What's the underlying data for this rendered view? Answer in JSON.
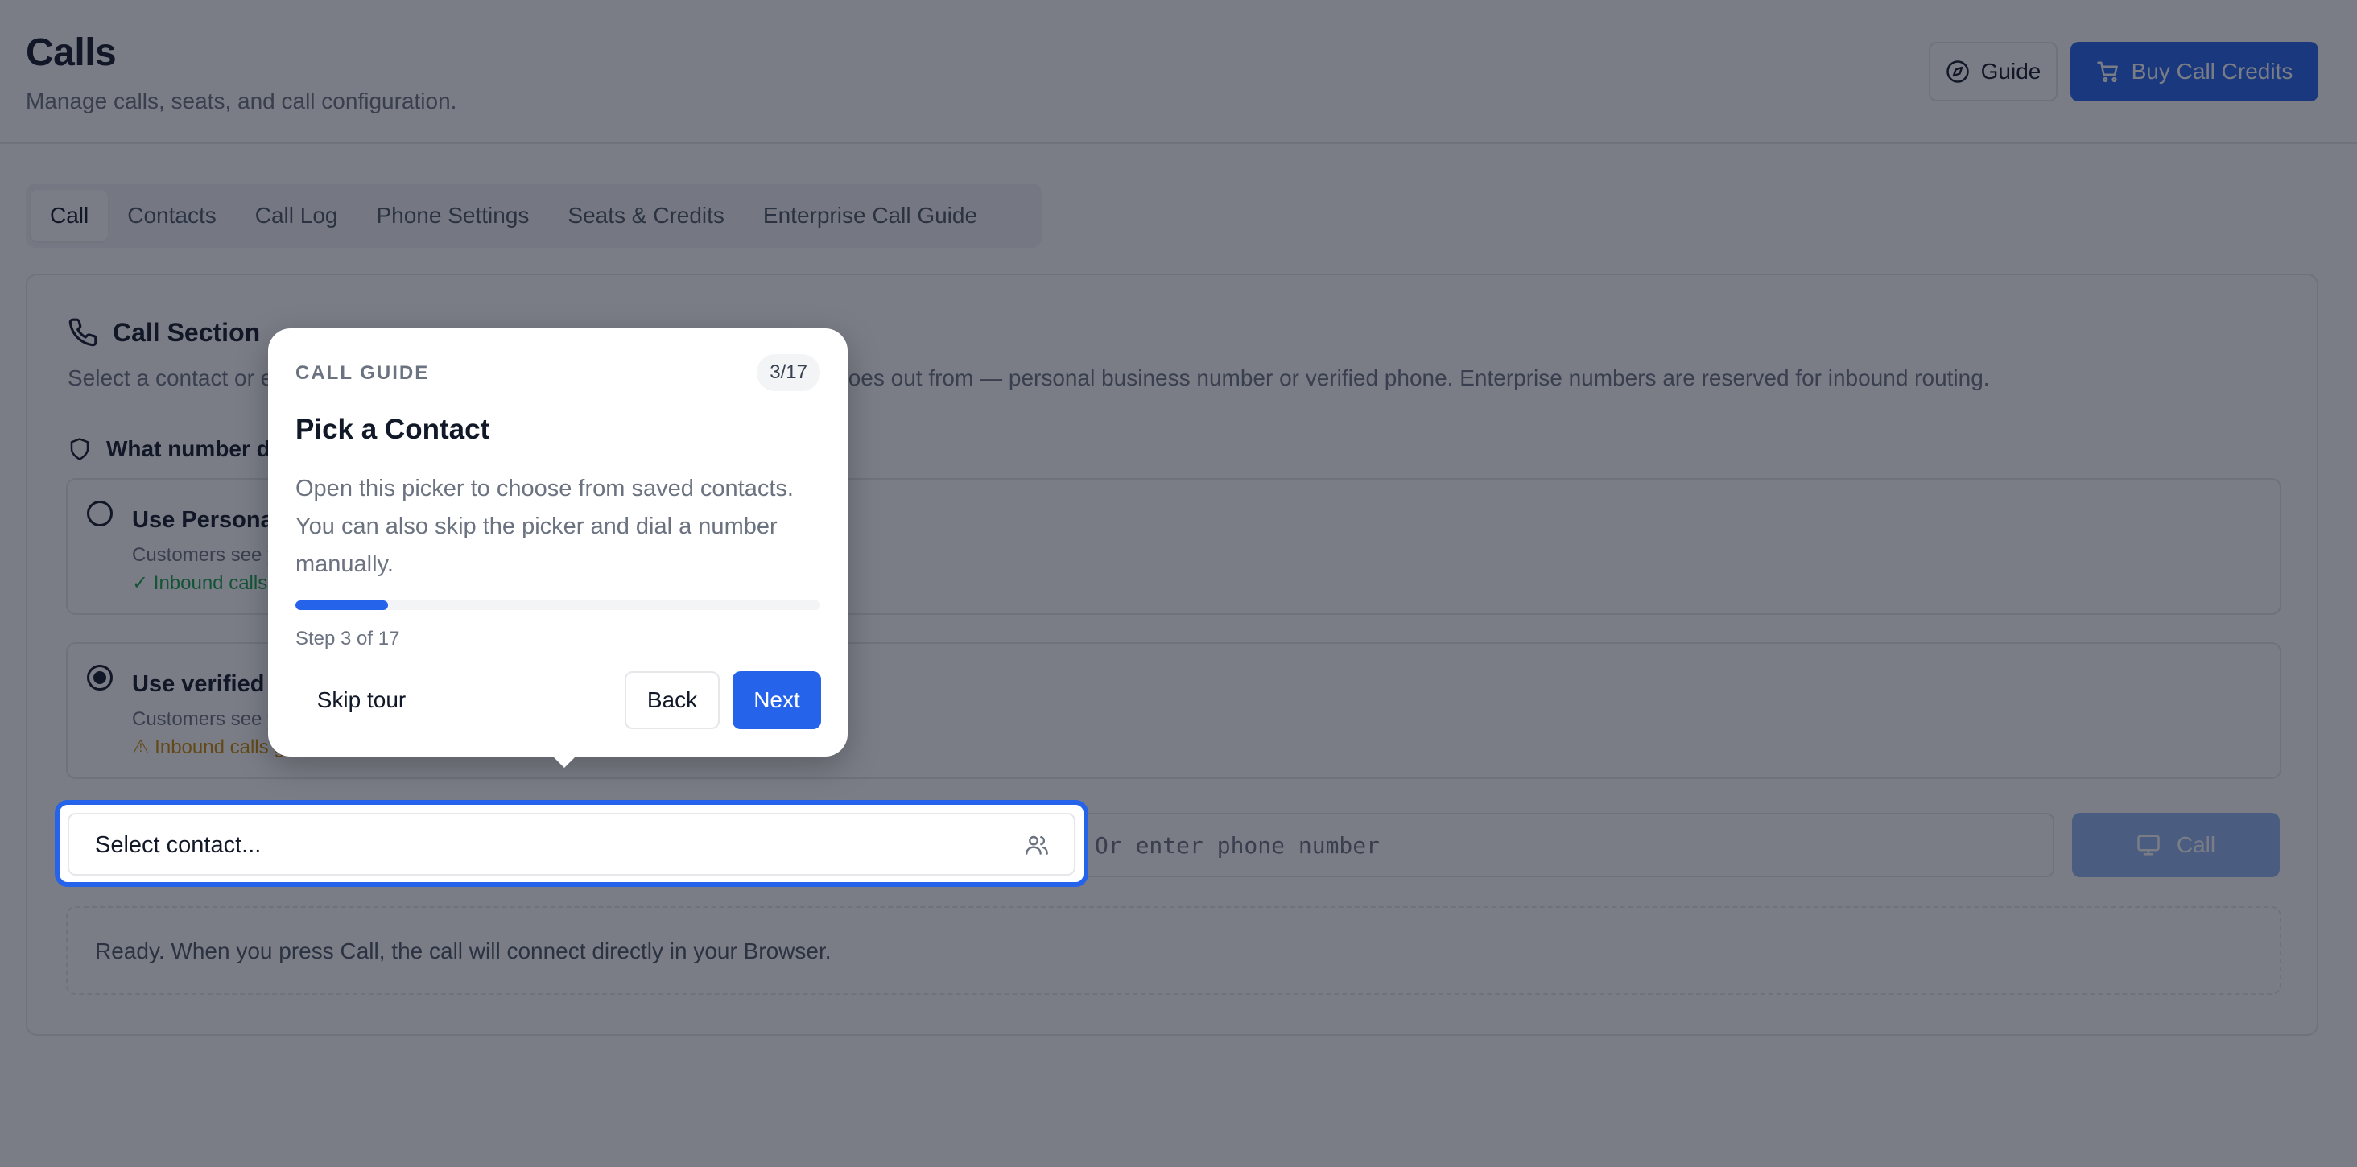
{
  "header": {
    "title": "Calls",
    "subtitle": "Manage calls, seats, and call configuration.",
    "guide_label": "Guide",
    "buy_label": "Buy Call Credits"
  },
  "tabs": [
    {
      "label": "Call",
      "active": true
    },
    {
      "label": "Contacts"
    },
    {
      "label": "Call Log"
    },
    {
      "label": "Phone Settings"
    },
    {
      "label": "Seats & Credits"
    },
    {
      "label": "Enterprise Call Guide"
    }
  ],
  "section": {
    "title": "Call Section",
    "description": "Select a contact or enter a phone number and choose which number the call goes out from — personal business number or verified phone. Enterprise numbers are reserved for inbound routing.",
    "question": "What number do customers see?"
  },
  "options": [
    {
      "title": "Use Personal business number",
      "subtitle": "Customers see your business number.",
      "note": "✓ Inbound calls route to you.",
      "checked": false
    },
    {
      "title": "Use verified phone",
      "subtitle": "Customers see your verified phone.",
      "note": "⚠ Inbound calls go to your phone directly.",
      "checked": true
    }
  ],
  "contact_select": {
    "label": "Select contact..."
  },
  "phone_input": {
    "placeholder": "Or enter phone number"
  },
  "call_button": {
    "label": "Call"
  },
  "status": {
    "text": "Ready. When you press Call, the call will connect directly in your Browser."
  },
  "tour": {
    "eyebrow": "CALL GUIDE",
    "count": "3/17",
    "title": "Pick a Contact",
    "body": "Open this picker to choose from saved contacts. You can also skip the picker and dial a number manually.",
    "progress": 0.1765,
    "step_text": "Step 3 of 17",
    "skip_label": "Skip tour",
    "back_label": "Back",
    "next_label": "Next"
  },
  "colors": {
    "primary": "#2563eb",
    "success": "#16a34a",
    "warning": "#ca8a04",
    "overlay": "rgba(17,24,39,0.56)"
  },
  "icons": {
    "guide": "compass-icon",
    "buy": "cart-icon",
    "section": "phone-icon",
    "question": "shield-icon",
    "contact": "users-icon",
    "call": "monitor-icon"
  }
}
